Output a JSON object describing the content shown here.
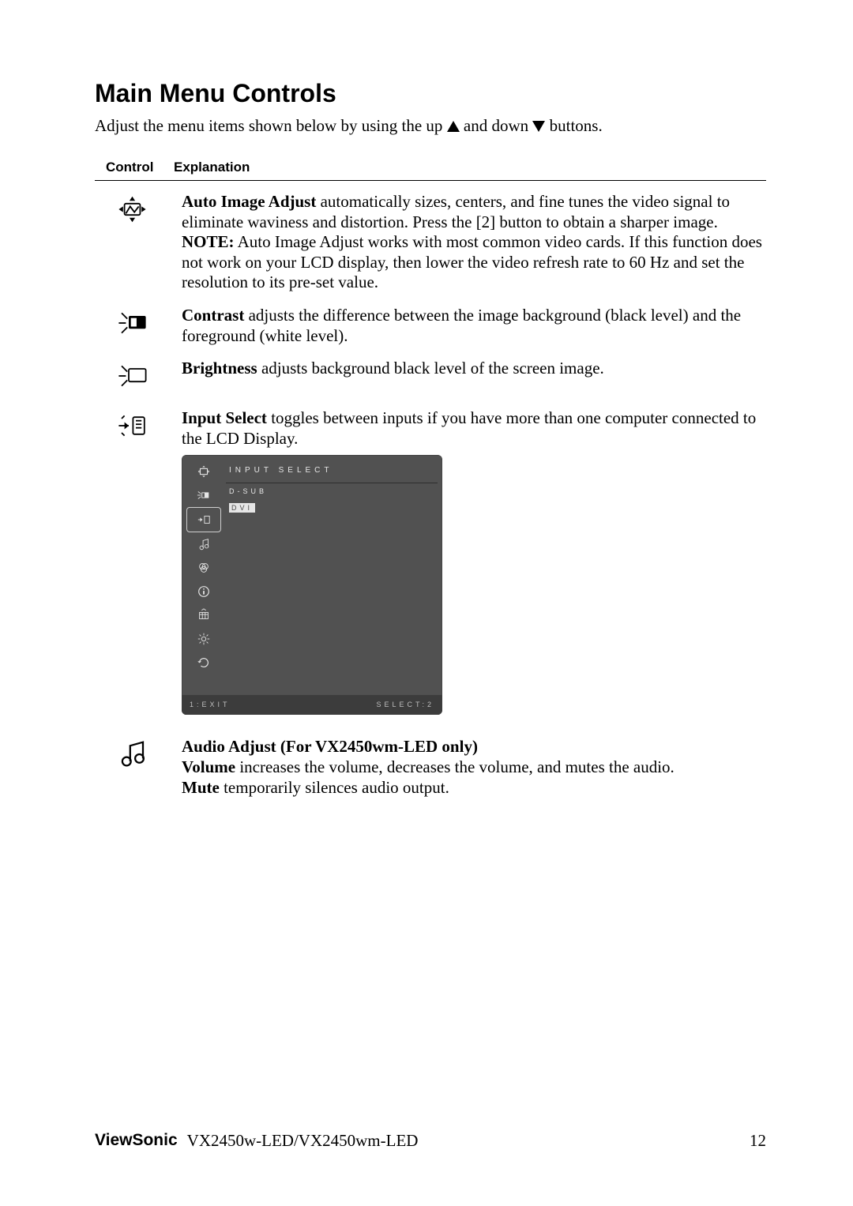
{
  "title": "Main Menu Controls",
  "intro_a": "Adjust the menu items shown below by using the up ",
  "intro_b": " and down ",
  "intro_c": " buttons.",
  "header_control": "Control",
  "header_explanation": "Explanation",
  "auto_image": {
    "b1": "Auto Image Adjust",
    "t1": " automatically sizes, centers, and fine tunes the video signal to eliminate waviness and distortion. Press the [2] button to obtain a sharper image.",
    "note_b": "NOTE:",
    "note_t": " Auto Image Adjust works with most common video cards. If this function does not work on your LCD display, then lower the video refresh rate to 60 Hz and set the resolution to its pre-set value."
  },
  "contrast": {
    "b": "Contrast",
    "t": " adjusts the difference between the image background (black level) and the foreground (white level)."
  },
  "brightness": {
    "b": "Brightness",
    "t": " adjusts background black level of the screen image."
  },
  "input_select": {
    "b": "Input Select",
    "t": " toggles between inputs if you have more than one computer connected to the LCD Display."
  },
  "osd": {
    "title": "INPUT SELECT",
    "opt1": "D-SUB",
    "opt2": "DVI",
    "exit": "1:EXIT",
    "select": "SELECT:2"
  },
  "audio": {
    "title": "Audio Adjust (For VX2450wm-LED only)",
    "vol_b": "Volume",
    "vol_t": " increases the volume, decreases the volume, and mutes the audio.",
    "mute_b": "Mute",
    "mute_t": " temporarily silences audio output."
  },
  "footer": {
    "brand": "ViewSonic",
    "model": "VX2450w-LED/VX2450wm-LED",
    "page": "12"
  }
}
